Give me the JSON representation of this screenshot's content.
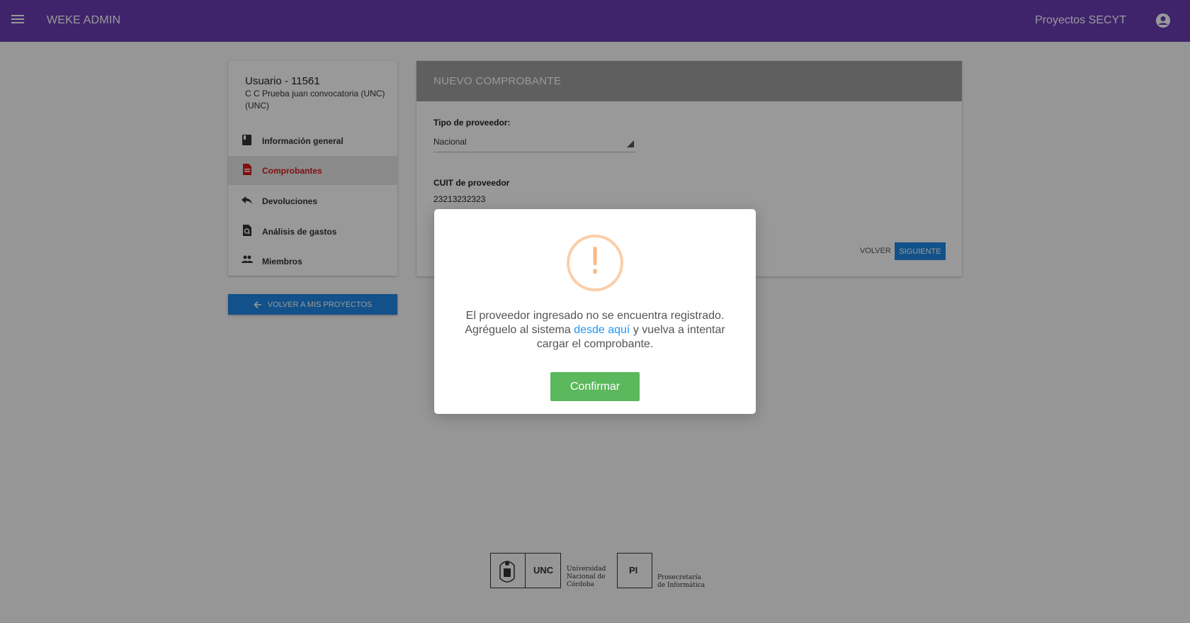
{
  "topbar": {
    "app_title": "WEKE ADMIN",
    "project_label": "Proyectos SECYT",
    "color": "#6a3cb5"
  },
  "sidebar": {
    "user_title": "Usuario - 11561",
    "user_subtitle": "C C Prueba juan convocatoria (UNC) (UNC)",
    "items": [
      {
        "label": "Información general",
        "icon": "book-icon",
        "active": false
      },
      {
        "label": "Comprobantes",
        "icon": "document-icon",
        "active": true
      },
      {
        "label": "Devoluciones",
        "icon": "reply-icon",
        "active": false
      },
      {
        "label": "Análisis de gastos",
        "icon": "search-document-icon",
        "active": false
      },
      {
        "label": "Miembros",
        "icon": "people-icon",
        "active": false
      }
    ],
    "back_button_label": "VOLVER A MIS PROYECTOS"
  },
  "form": {
    "header": "NUEVO COMPROBANTE",
    "provider_type_label": "Tipo de proveedor:",
    "provider_type_value": "Nacional",
    "cuit_label": "CUIT de proveedor",
    "cuit_value": "23213232323",
    "back_label": "VOLVER",
    "next_label": "SIGUIENTE"
  },
  "modal": {
    "icon": "warning-icon",
    "text_before_link": "El proveedor ingresado no se encuentra registrado. Agréguelo al sistema ",
    "link_text": "desde aquí",
    "text_after_link": " y vuelva a intentar cargar el comprobante.",
    "confirm_label": "Confirmar",
    "confirm_color": "#5cb85c"
  },
  "footer": {
    "unc_abbr": "UNC",
    "unc_name": "Universidad Nacional de Córdoba",
    "pi_abbr": "PI",
    "pi_name": "Prosecretaría de Informática"
  }
}
